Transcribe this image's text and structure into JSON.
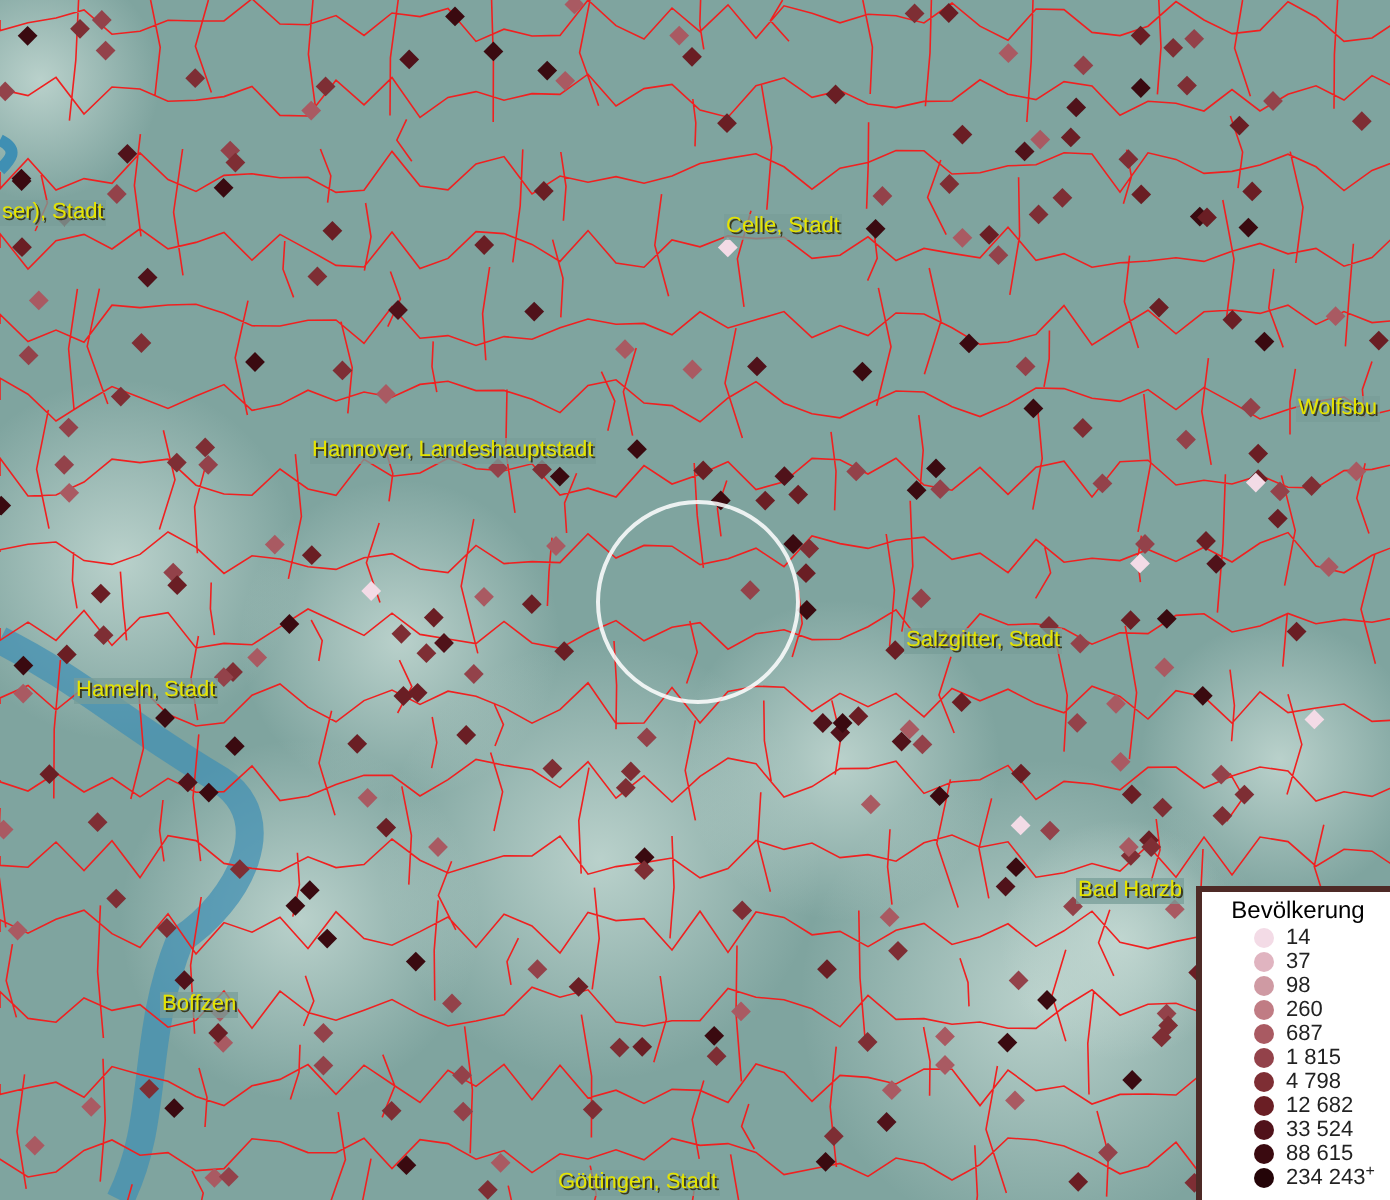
{
  "map": {
    "labels": [
      "ser), Stadt",
      "Celle, Stadt",
      "Hannover, Landeshauptstadt",
      "Wolfsbu",
      "Salzgitter, Stadt",
      "Hameln, Stadt",
      "Bad Harzb",
      "Boffzen",
      "Göttingen, Stadt"
    ]
  },
  "legend": {
    "title": "Bevölkerung",
    "items": [
      {
        "value": "14",
        "color": "#f3dbe6"
      },
      {
        "value": "37",
        "color": "#e0b4c0"
      },
      {
        "value": "98",
        "color": "#cf9aa3"
      },
      {
        "value": "260",
        "color": "#c07c84"
      },
      {
        "value": "687",
        "color": "#a95a62"
      },
      {
        "value": "1 815",
        "color": "#93424a"
      },
      {
        "value": "4 798",
        "color": "#7e2e34"
      },
      {
        "value": "12 682",
        "color": "#6a1e24"
      },
      {
        "value": "33 524",
        "color": "#50121a"
      },
      {
        "value": "88 615",
        "color": "#3a0a10"
      },
      {
        "value": "234 243$^{+}$",
        "color": "#240408"
      }
    ]
  }
}
